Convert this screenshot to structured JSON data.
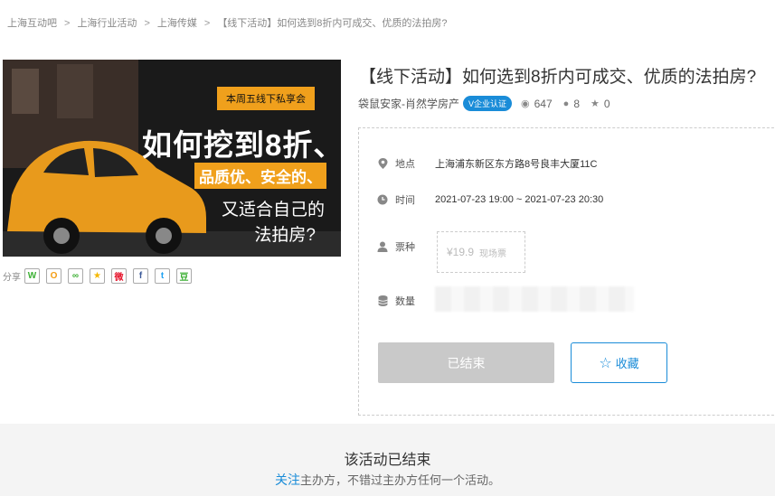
{
  "breadcrumb": [
    "上海互动吧",
    "上海行业活动",
    "上海传媒",
    "【线下活动】如何选到8折内可成交、优质的法拍房?"
  ],
  "breadcrumb_sep": ">",
  "poster": {
    "tag": "本周五线下私享会",
    "big": "如何挖到8折、",
    "highlight": "品质优、安全的、",
    "line3": "又适合自己的",
    "line4": "法拍房?"
  },
  "share": {
    "label": "分享",
    "icons": [
      "wechat-icon",
      "moments-icon",
      "link-icon",
      "qzone-icon",
      "weibo-icon",
      "facebook-icon",
      "twitter-icon",
      "douban-icon"
    ],
    "glyphs": [
      "W",
      "O",
      "🔗",
      "★",
      "微",
      "f",
      "t",
      "豆"
    ],
    "colors": [
      "#3cb034",
      "#f39c12",
      "#3cb034",
      "#f5b800",
      "#e6162d",
      "#3b5998",
      "#1da1f2",
      "#3cb034"
    ]
  },
  "title": "【线下活动】如何选到8折内可成交、优质的法拍房?",
  "organizer": "袋鼠安家-肖然学房产",
  "badge": "V企业认证",
  "stats": {
    "views": "647",
    "comments": "8",
    "stars": "0"
  },
  "info": {
    "location_label": "地点",
    "location": "上海浦东新区东方路8号良丰大厦11C",
    "time_label": "时间",
    "time": "2021-07-23 19:00 ~ 2021-07-23 20:30",
    "ticket_label": "票种",
    "ticket_price": "¥19.9",
    "ticket_type": "现场票",
    "count_label": "数量"
  },
  "buttons": {
    "ended": "已结束",
    "favorite": "收藏"
  },
  "notice": {
    "heading": "该活动已结束",
    "follow": "关注",
    "text": "主办方，不错过主办方任何一个活动。"
  },
  "colors": {
    "accent": "#1a8cd8",
    "poster_orange": "#f0a01c"
  }
}
